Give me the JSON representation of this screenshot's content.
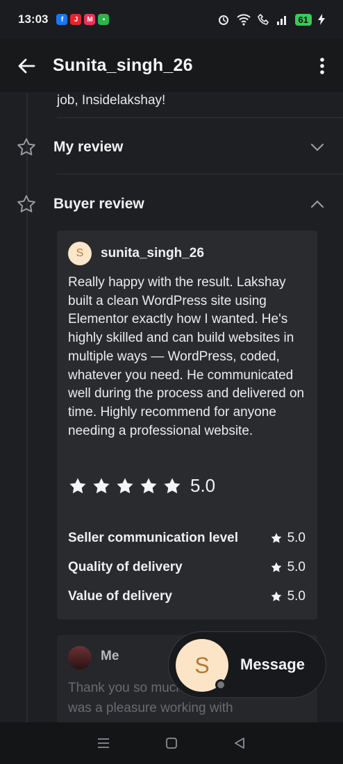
{
  "status_bar": {
    "time": "13:03",
    "battery": "61"
  },
  "header": {
    "title": "Sunita_singh_26"
  },
  "previous_message": {
    "text": "job, Insidelakshay!"
  },
  "sections": {
    "my_review_label": "My review",
    "buyer_review_label": "Buyer review"
  },
  "buyer_review": {
    "avatar_initial": "S",
    "reviewer_name": "sunita_singh_26",
    "text": "Really happy with the result. Lakshay built a clean WordPress site using Elementor exactly how I wanted. He's highly skilled and can build websites in multiple ways — WordPress, coded, whatever you need. He communicated well during the process and delivered on time. Highly recommend for anyone needing a professional website.",
    "stars": 5,
    "rating": "5.0",
    "sub_ratings": [
      {
        "label": "Seller communication level",
        "value": "5.0"
      },
      {
        "label": "Quality of delivery",
        "value": "5.0"
      },
      {
        "label": "Value of delivery",
        "value": "5.0"
      }
    ]
  },
  "reply": {
    "name": "Me",
    "text": "Thank you so much for the kind words! It was a pleasure working with"
  },
  "message_fab": {
    "avatar_initial": "S",
    "label": "Message"
  },
  "colors": {
    "background": "#1e1f22",
    "card": "#2a2b2e",
    "fab_avatar": "#fce5c6"
  }
}
